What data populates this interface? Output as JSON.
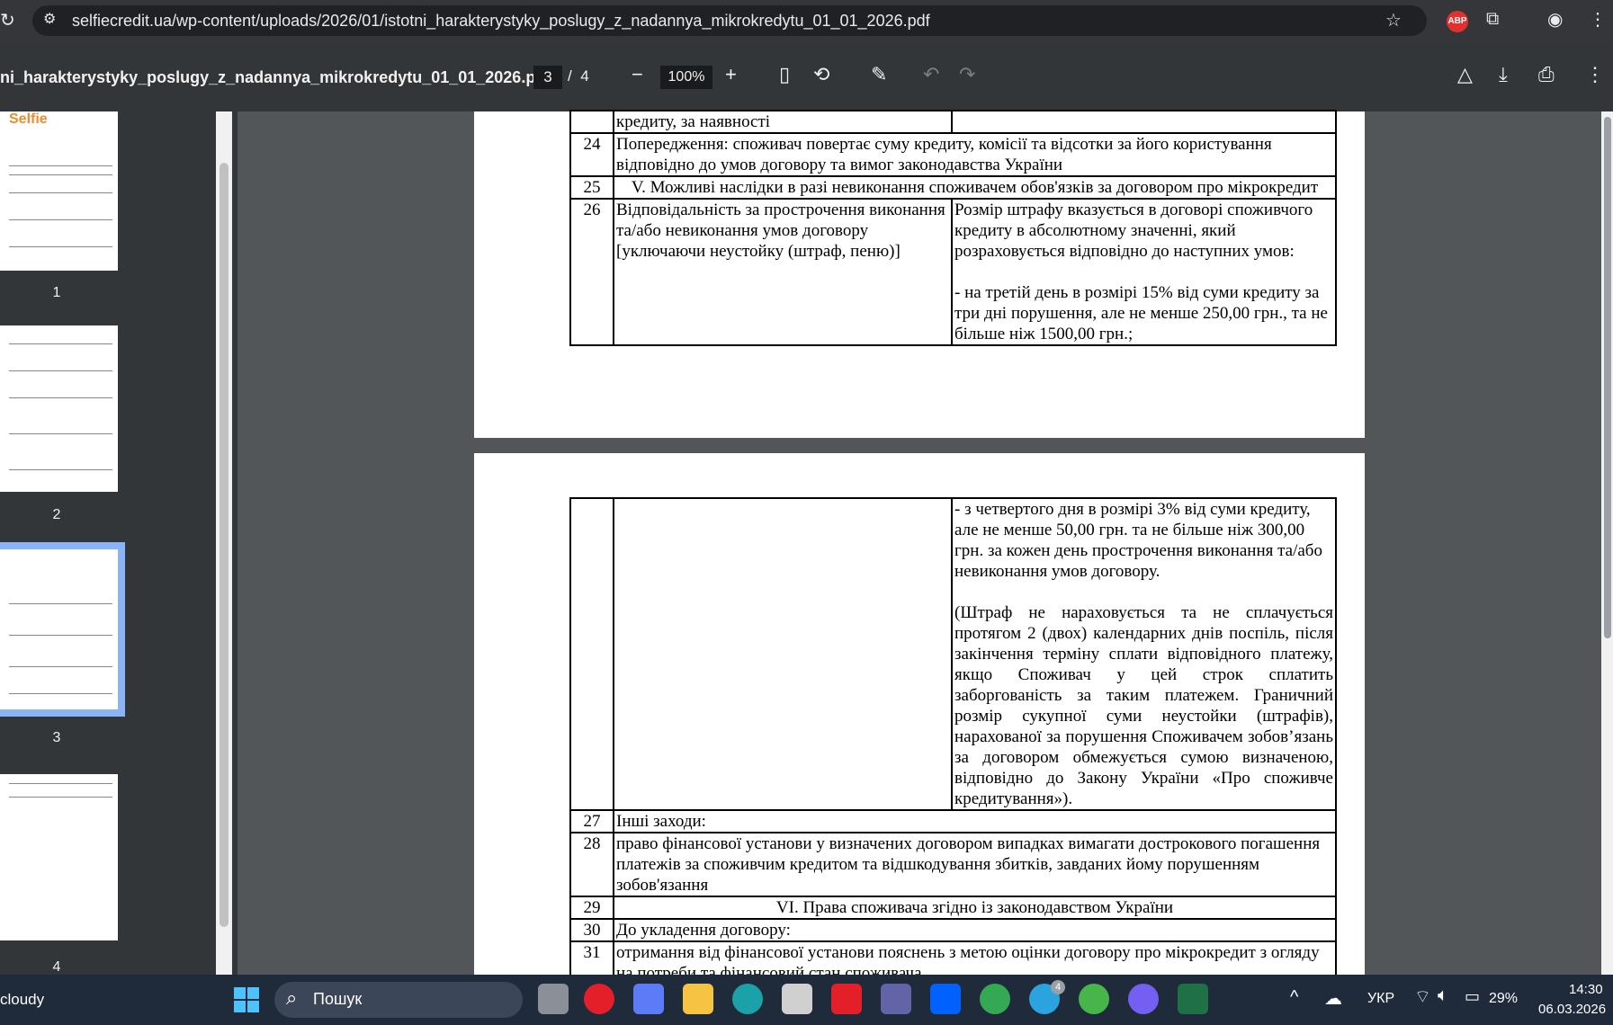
{
  "browser": {
    "url": "selfiecredit.ua/wp-content/uploads/2026/01/istotni_harakterystyky_poslugy_z_nadannya_mikrokredytu_01_01_2026.pdf",
    "extension_badge": "ABP"
  },
  "pdf_toolbar": {
    "title": "ni_harakterystyky_poslugy_z_nadannya_mikrokredytu_01_01_2026.pdf",
    "current_page": "3",
    "separator": "/",
    "total_pages": "4",
    "zoom": "100%"
  },
  "thumbnails": [
    {
      "label": "1",
      "logo": "Selfie"
    },
    {
      "label": "2"
    },
    {
      "label": "3"
    },
    {
      "label": "4"
    }
  ],
  "page3": {
    "row23_cont": "кредиту, за наявності",
    "rows": [
      {
        "num": "24",
        "text": "Попередження: споживач повертає суму кредиту, комісії та відсотки за його користування відповідно до умов договору та вимог законодавства України"
      },
      {
        "num": "25",
        "text": "V. Можливі наслідки в разі невиконання споживачем обов'язків за договором про мікрокредит"
      }
    ],
    "row26": {
      "num": "26",
      "left": "Відповідальність за прострочення виконання та/або невиконання умов договору [уключаючи неустойку (штраф, пеню)]",
      "right_p1": "Розмір штрафу вказується в договорі споживчого кредиту в абсолютному значенні, який розраховується відповідно до наступних умов:",
      "right_p2": "- на третій день в розмірі 15% від суми кредиту за три дні порушення, але не менше 250,00 грн., та не більше ніж 1500,00 грн.;"
    }
  },
  "page4": {
    "cont_p1": "- з четвертого дня в розмірі 3% від суми кредиту, але не менше 50,00 грн. та не більше ніж 300,00 грн.  за кожен день прострочення виконання та/або невиконання умов договору.",
    "cont_p2": "(Штраф не нараховується та не сплачується протягом 2 (двох) календарних днів поспіль, після закінчення терміну сплати відповідного платежу, якщо Споживач у цей строк сплатить заборгованість за таким платежем. Граничний розмір сукупної суми неустойки (штрафів), нарахованої за порушення Споживачем зобов’язань за договором обмежується сумою визначеною, відповідно до Закону України «Про споживче кредитування»).",
    "rows": [
      {
        "num": "27",
        "text": "Інші заходи:"
      },
      {
        "num": "28",
        "text": "право фінансової установи у визначених договором випадках вимагати дострокового погашення платежів за споживчим кредитом та відшкодування збитків, завданих йому порушенням зобов'язання"
      },
      {
        "num": "29",
        "text": "VI. Права споживача згідно із законодавством України"
      },
      {
        "num": "30",
        "text": "До укладення договору:"
      },
      {
        "num": "31",
        "text": "отримання від фінансової установи пояснень з метою оцінки договору про мікрокредит з огляду на потреби та фінансовий стан споживача"
      }
    ]
  },
  "taskbar": {
    "weather": "cloudy",
    "search_placeholder": "Пошук",
    "language": "УКР",
    "battery": "29%",
    "time": "14:30",
    "date": "06.03.2026",
    "telegram_badge": "4"
  }
}
